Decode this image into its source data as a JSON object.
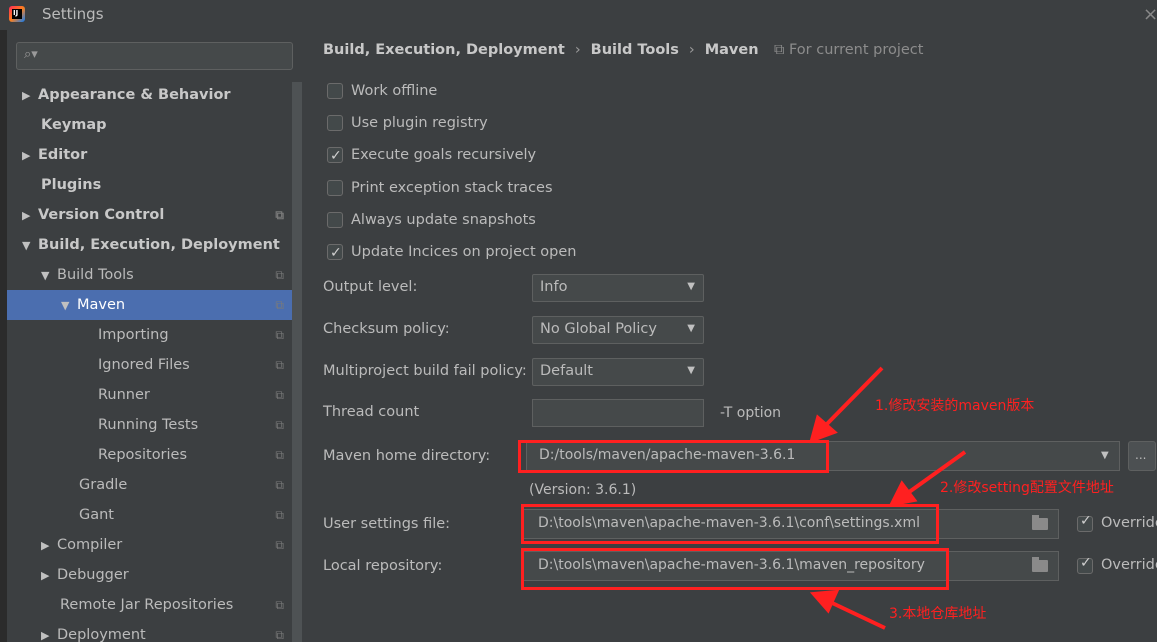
{
  "window": {
    "title": "Settings",
    "close_glyph": "×",
    "app_icon_letter": "IJ"
  },
  "search": {
    "icon": "⌕▾",
    "placeholder": ""
  },
  "sidebar": {
    "items": [
      {
        "label": "Appearance & Behavior",
        "arrow": "▶"
      },
      {
        "label": "Keymap"
      },
      {
        "label": "Editor",
        "arrow": "▶"
      },
      {
        "label": "Plugins"
      },
      {
        "label": "Version Control",
        "arrow": "▶"
      },
      {
        "label": "Build, Execution, Deployment",
        "arrow": "▼"
      },
      {
        "label": "Build Tools",
        "arrow": "▼"
      },
      {
        "label": "Maven",
        "arrow": "▼"
      },
      {
        "label": "Importing"
      },
      {
        "label": "Ignored Files"
      },
      {
        "label": "Runner"
      },
      {
        "label": "Running Tests"
      },
      {
        "label": "Repositories"
      },
      {
        "label": "Gradle"
      },
      {
        "label": "Gant"
      },
      {
        "label": "Compiler",
        "arrow": "▶"
      },
      {
        "label": "Debugger",
        "arrow": "▶"
      },
      {
        "label": "Remote Jar Repositories"
      },
      {
        "label": "Deployment",
        "arrow": "▶"
      }
    ],
    "selected": "Maven"
  },
  "breadcrumb": {
    "items": [
      "Build, Execution, Deployment",
      "Build Tools",
      "Maven"
    ],
    "separator": "›",
    "scope": "⧉ For current project"
  },
  "checkboxes": [
    {
      "label": "Work offline",
      "checked": false
    },
    {
      "label": "Use plugin registry",
      "checked": false
    },
    {
      "label": "Execute goals recursively",
      "checked": true
    },
    {
      "label": "Print exception stack traces",
      "checked": false
    },
    {
      "label": "Always update snapshots",
      "checked": false
    },
    {
      "label": "Update Incices on project open",
      "checked": true
    }
  ],
  "fields": {
    "output_level": {
      "label": "Output level:",
      "value": "Info"
    },
    "checksum_policy": {
      "label": "Checksum policy:",
      "value": "No Global Policy"
    },
    "fail_policy": {
      "label": "Multiproject build fail policy:",
      "value": "Default"
    },
    "thread_count": {
      "label": "Thread count",
      "value": "",
      "suffix": "-T option"
    },
    "maven_home": {
      "label": "Maven home directory:",
      "value": "D:/tools/maven/apache-maven-3.6.1",
      "version": "(Version: 3.6.1)",
      "browse": "..."
    },
    "user_settings": {
      "label": "User settings file:",
      "value": "D:\\tools\\maven\\apache-maven-3.6.1\\conf\\settings.xml",
      "override_label": "Override",
      "override_checked": true
    },
    "local_repo": {
      "label": "Local repository:",
      "value": "D:\\tools\\maven\\apache-maven-3.6.1\\maven_repository",
      "override_label": "Override",
      "override_checked": true
    }
  },
  "annotations": {
    "a1": "1.修改安装的maven版本",
    "a2": "2.修改setting配置文件地址",
    "a3": "3.本地仓库地址"
  },
  "colors": {
    "background": "#3c3f41",
    "selection": "#4b6eaf",
    "annotation": "#ff2020"
  }
}
